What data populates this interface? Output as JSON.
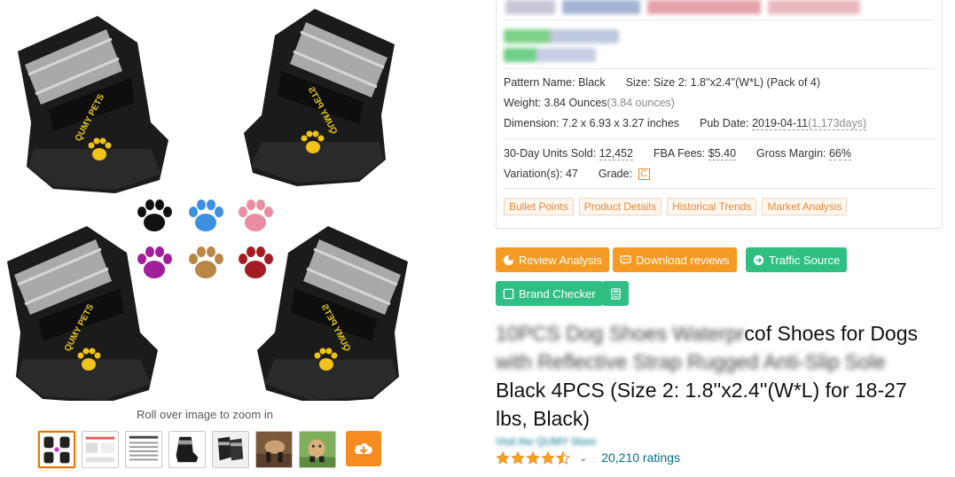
{
  "gallery": {
    "zoom_hint": "Roll over image to zoom in",
    "thumbnails": [
      {
        "name": "thumb-main-product",
        "active": true
      },
      {
        "name": "thumb-size-chart-1",
        "active": false
      },
      {
        "name": "thumb-size-chart-2",
        "active": false
      },
      {
        "name": "thumb-single-shoe",
        "active": false
      },
      {
        "name": "thumb-shoe-pair",
        "active": false
      },
      {
        "name": "thumb-dog-wearing",
        "active": false
      },
      {
        "name": "thumb-dog-outdoor",
        "active": false
      }
    ],
    "download_icon": "cloud-download-icon"
  },
  "panel": {
    "pattern_label": "Pattern Name:",
    "pattern_value": "Black",
    "size_label": "Size:",
    "size_value": "Size 2: 1.8''x2.4''(W*L) (Pack of 4)",
    "weight_label": "Weight:",
    "weight_value": "3.84 Ounces",
    "weight_alt": "(3.84 ounces)",
    "dimension_label": "Dimension:",
    "dimension_value": "7.2 x 6.93 x 3.27 inches",
    "pubdate_label": "Pub Date:",
    "pubdate_value": "2019-04-11",
    "pubdate_days": "(1,173days)",
    "units_label": "30-Day Units Sold:",
    "units_value": "12,452",
    "fba_label": "FBA Fees:",
    "fba_value": "$5.40",
    "margin_label": "Gross Margin:",
    "margin_value": "66%",
    "variation_label": "Variation(s):",
    "variation_value": "47",
    "grade_label": "Grade:",
    "grade_value": "C",
    "tabs": [
      "Bullet Points",
      "Product Details",
      "Historical Trends",
      "Market Analysis"
    ]
  },
  "actions": {
    "review_analysis": "Review Analysis",
    "download_reviews": "Download reviews",
    "traffic_source": "Traffic Source",
    "brand_checker": "Brand Checker"
  },
  "product": {
    "title_line1_visible": "cof Shoes for Dogs",
    "title_line3": "Black 4PCS (Size 2: 1.8''x2.4''(W*L) for 18-27",
    "title_line4": "lbs, Black)",
    "rating_stars": 4.5,
    "ratings_count": "20,210 ratings"
  },
  "colors": {
    "accent_orange": "#f59a23",
    "accent_green": "#2fbf83",
    "link": "#007185",
    "star": "#f7a41d"
  }
}
